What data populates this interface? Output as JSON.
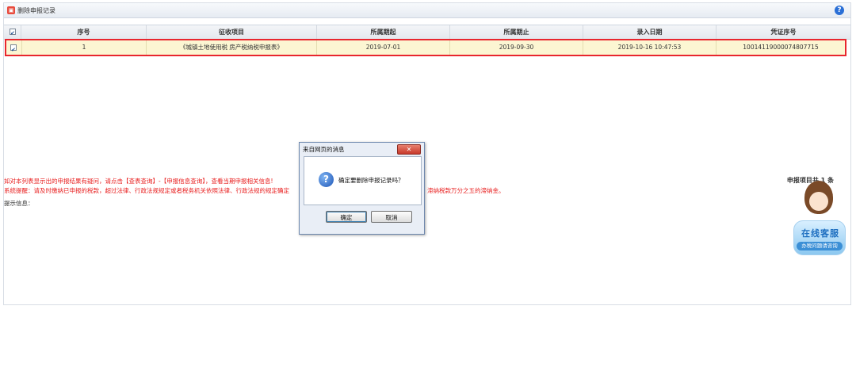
{
  "window": {
    "title": "删除申报记录",
    "help_icon": "question-circle-icon"
  },
  "table": {
    "headers": [
      "序号",
      "征收项目",
      "所属期起",
      "所属期止",
      "录入日期",
      "凭证序号"
    ],
    "rows": [
      {
        "checked": true,
        "seq": "1",
        "item": "《城镇土地使用税 房产税纳税申报表》",
        "start": "2019-07-01",
        "end": "2019-09-30",
        "entry_date": "2019-10-16 10:47:53",
        "voucher": "10014119000074807715"
      }
    ]
  },
  "messages": {
    "line1": "如对本列表显示出的申报结果有疑问，请点击【查表查询】-【申报信息查询】，查看当期申报相关信息!",
    "line2_a": "系统提醒：请及时缴纳已申报的税款，超过法律、行政法规规定或者税务机关依照法律、行政法规的规定确定",
    "line2_b": "滞纳税款万分之五的滞纳金。",
    "line3": "提示信息："
  },
  "record_count": "申报项目共 1 条",
  "dialog": {
    "title": "来自网页的消息",
    "message": "确定要删除申报记录吗？",
    "ok_label": "确定",
    "cancel_label": "取消"
  },
  "customer_service": {
    "title": "在线客服",
    "subtitle": "办税问题请咨询"
  }
}
